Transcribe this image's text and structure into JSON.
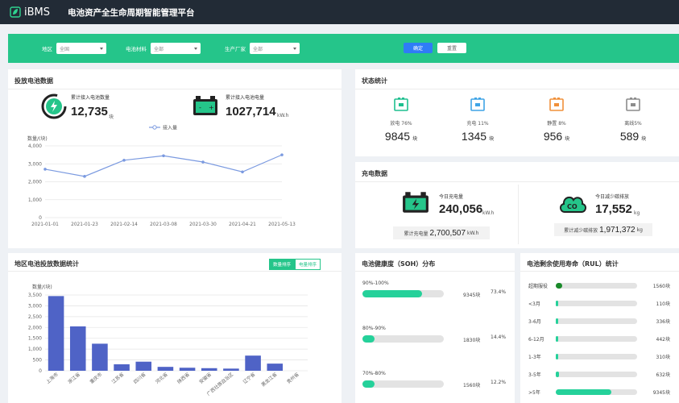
{
  "header": {
    "logo": "iBMS",
    "title": "电池资产全生命周期智能管理平台"
  },
  "filters": {
    "region_label": "地区",
    "region_value": "全国",
    "material_label": "电池材料",
    "material_value": "全部",
    "maker_label": "生产厂家",
    "maker_value": "全部",
    "confirm": "确定",
    "reset": "重置"
  },
  "deploy": {
    "title": "投放电池数据",
    "count_label": "累计接入电池数量",
    "count_value": "12,735",
    "count_unit": "块",
    "energy_label": "累计接入电池电量",
    "energy_value": "1027,714",
    "energy_unit": "kW.h"
  },
  "line_chart": {
    "legend": "接入量",
    "ylabel": "数量/(块)",
    "yticks": [
      "0",
      "1,000",
      "2,000",
      "3,000",
      "4,000"
    ],
    "x": [
      "2021-01-01",
      "2021-01-23",
      "2021-02-14",
      "2021-03-08",
      "2021-03-30",
      "2021-04-21",
      "2021-05-13"
    ],
    "values": [
      2700,
      2300,
      3200,
      3450,
      3100,
      2550,
      3500
    ],
    "ylim": [
      0,
      4000
    ],
    "color": "#7b9ae0"
  },
  "status": {
    "title": "状态统计",
    "items": [
      {
        "label": "放电 76%",
        "value": "9845",
        "unit": "块",
        "color": "#1fbf8f",
        "icon": "battery-discharge-icon"
      },
      {
        "label": "充电 11%",
        "value": "1345",
        "unit": "块",
        "color": "#3fa4e6",
        "icon": "battery-charge-icon"
      },
      {
        "label": "静置 8%",
        "value": "956",
        "unit": "块",
        "color": "#f0903a",
        "icon": "battery-idle-icon"
      },
      {
        "label": "离线5%",
        "value": "589",
        "unit": "块",
        "color": "#8c8c8c",
        "icon": "battery-offline-icon"
      }
    ]
  },
  "charging": {
    "title": "充电数据",
    "today_label": "今日充电量",
    "today_value": "240,056",
    "today_unit": "kW.h",
    "total_label": "累计充电量",
    "total_value": "2,700,507",
    "total_unit": "kW.h",
    "co2_label": "今日减少碳排放",
    "co2_value": "17,552",
    "co2_unit": "kg",
    "co2_total_label": "累计减少碳排放",
    "co2_total_value": "1,971,372",
    "co2_total_unit": "kg"
  },
  "region": {
    "title": "地区电池投放数据统计",
    "toggle_on": "数量排序",
    "toggle_off": "电量排序"
  },
  "chart_data": {
    "type": "bar",
    "ylabel": "数量/(块)",
    "yticks": [
      "0",
      "500",
      "1,000",
      "1,500",
      "2,000",
      "2,500",
      "3,000",
      "3,500"
    ],
    "ylim": [
      0,
      3500
    ],
    "categories": [
      "上海市",
      "浙江省",
      "重庆市",
      "江苏省",
      "四川省",
      "河北省",
      "陕西省",
      "安徽省",
      "广西壮族自治区",
      "辽宁省",
      "黑龙江省",
      "贵州省"
    ],
    "values": [
      3450,
      2050,
      1250,
      300,
      420,
      180,
      140,
      120,
      100,
      700,
      330,
      0
    ],
    "color": "#4f63c6"
  },
  "soh": {
    "title": "电池健康度（SOH）分布",
    "rows": [
      {
        "label": "90%-100%",
        "count": "9345块",
        "pct": "73.4%",
        "fill": 0.734
      },
      {
        "label": "80%-90%",
        "count": "1830块",
        "pct": "14.4%",
        "fill": 0.144
      },
      {
        "label": "70%-80%",
        "count": "1560块",
        "pct": "12.2%",
        "fill": 0.122
      }
    ]
  },
  "rul": {
    "title": "电池剩余使用寿命（RUL）统计",
    "rows": [
      {
        "label": "超期服役",
        "count": "1560块",
        "fill": 0.08,
        "color": "#1a8a2a"
      },
      {
        "label": "<3月",
        "count": "110块",
        "fill": 0.012,
        "color": "#25d19a"
      },
      {
        "label": "3-6月",
        "count": "336块",
        "fill": 0.02,
        "color": "#25d19a"
      },
      {
        "label": "6-12月",
        "count": "442块",
        "fill": 0.025,
        "color": "#25d19a"
      },
      {
        "label": "1-3年",
        "count": "310块",
        "fill": 0.018,
        "color": "#25d19a"
      },
      {
        "label": "3-5年",
        "count": "632块",
        "fill": 0.035,
        "color": "#25d19a"
      },
      {
        "label": ">5年",
        "count": "9345块",
        "fill": 0.68,
        "color": "#25d19a"
      }
    ]
  }
}
